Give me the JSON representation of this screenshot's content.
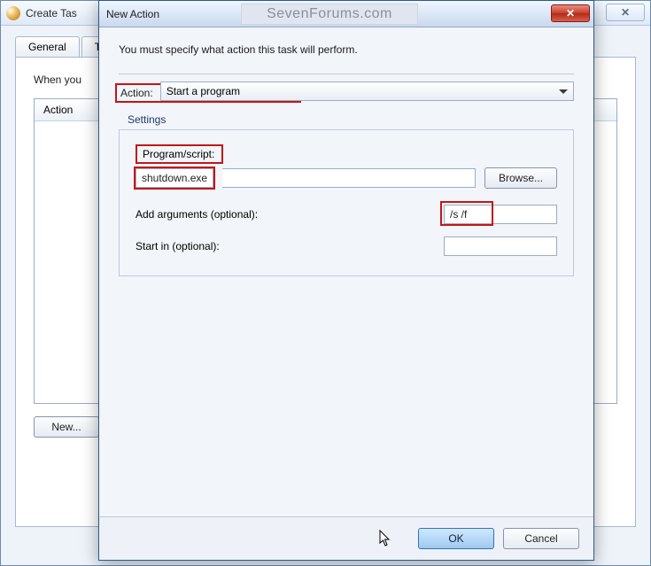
{
  "watermark": "SevenForums.com",
  "background_window": {
    "title": "Create Tas",
    "close_glyph": "✕",
    "tabs": [
      "General",
      "Tr"
    ],
    "intro_fragment": "When you",
    "table_header": "Action",
    "new_button": "New..."
  },
  "dialog": {
    "title": "New Action",
    "close_glyph": "✕",
    "instruction": "You must specify what action this task will perform.",
    "action_label": "Action:",
    "action_value": "Start a program",
    "settings_label": "Settings",
    "program_label": "Program/script:",
    "program_value": "shutdown.exe",
    "browse_button": "Browse...",
    "args_label": "Add arguments (optional):",
    "args_value": "/s /f",
    "startin_label": "Start in (optional):",
    "startin_value": "",
    "ok_button": "OK",
    "cancel_button": "Cancel"
  }
}
